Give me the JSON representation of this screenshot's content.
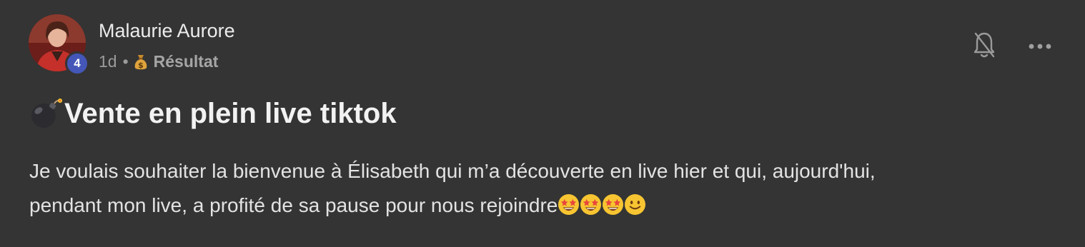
{
  "post": {
    "author": {
      "name": "Malaurie Aurore",
      "level": "4"
    },
    "meta": {
      "time": "1d",
      "separator": "•",
      "category": "Résultat",
      "category_icon": "money-bag-icon"
    },
    "title": "Vente en plein live tiktok",
    "title_icon": "bomb-icon",
    "body": {
      "line1": "Je voulais souhaiter la bienvenue à Élisabeth qui m’a découverte en live hier et qui, aujourd'hui,",
      "line2": "pendant mon live, a profité de sa pause pour nous rejoindre",
      "trailing_emojis": [
        "star-struck-icon",
        "star-struck-icon",
        "star-struck-icon",
        "smiling-face-icon"
      ]
    },
    "actions": {
      "notifications_icon": "bell-off-icon",
      "more_icon": "more-options-icon"
    }
  },
  "colors": {
    "background": "#343434",
    "badge": "#4457b8",
    "text_primary": "#ececec",
    "text_secondary": "#9b9b9b"
  }
}
